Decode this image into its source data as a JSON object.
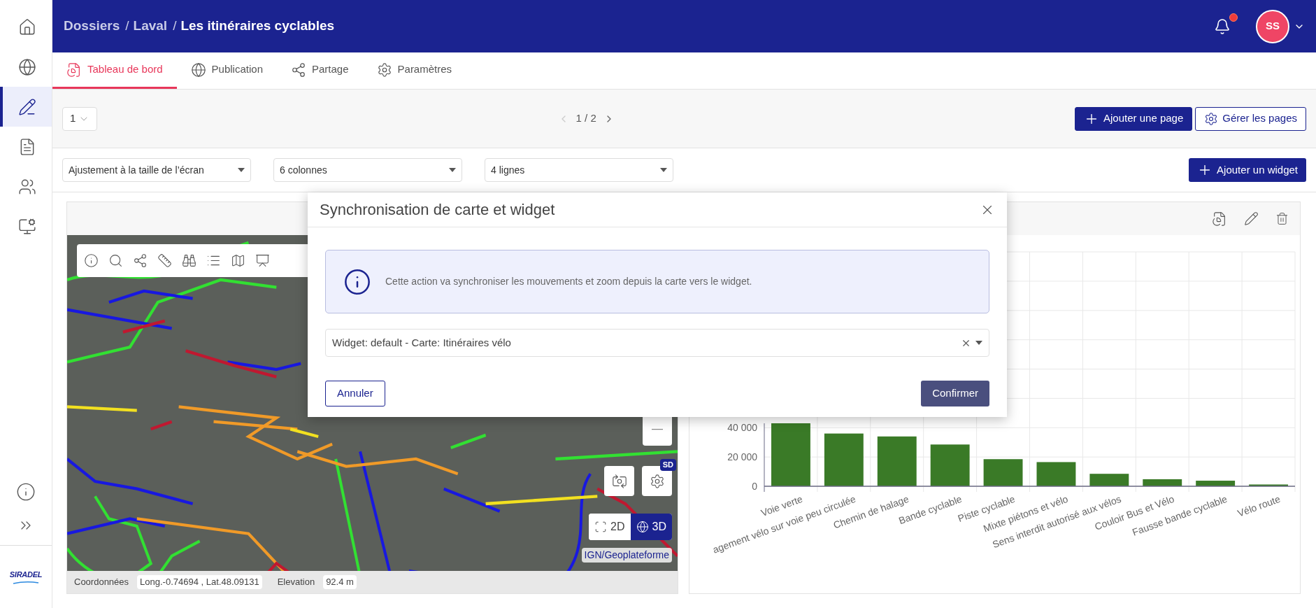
{
  "sidebar": {
    "items": [
      {
        "selected": false
      },
      {
        "selected": false
      },
      {
        "selected": true
      },
      {
        "selected": false
      },
      {
        "selected": false
      },
      {
        "selected": false
      }
    ],
    "logo": "SIRADEL"
  },
  "header": {
    "breadcrumb": [
      {
        "label": "Dossiers",
        "current": false
      },
      {
        "label": "Laval",
        "current": false
      },
      {
        "label": "Les itinéraires cyclables",
        "current": true
      }
    ],
    "separator": "/",
    "notifications_unread": true,
    "avatar": "SS"
  },
  "tabs": [
    {
      "label": "Tableau de bord",
      "selected": true
    },
    {
      "label": "Publication",
      "selected": false
    },
    {
      "label": "Partage",
      "selected": false
    },
    {
      "label": "Paramètres",
      "selected": false
    }
  ],
  "page_toolbar": {
    "page_select": "1",
    "pagination": {
      "label": "1 / 2",
      "prev_disabled": true,
      "next_disabled": false
    },
    "buttons": [
      {
        "label": "Ajouter une page",
        "kind": "primary"
      },
      {
        "label": "Gérer les pages",
        "kind": "secondary"
      }
    ]
  },
  "layout_toolbar": {
    "selects": [
      "Ajustement à la taille de l’écran",
      "6 colonnes",
      "4 lignes"
    ],
    "add_widget": "Ajouter un widget"
  },
  "map_widget": {
    "view_modes": [
      {
        "label": "2D",
        "selected": false
      },
      {
        "label": "3D",
        "selected": true
      }
    ],
    "quality_badge": "SD",
    "attribution": "IGN/Geoplateforme",
    "status": {
      "coords_label": "Coordonnées",
      "coords": "Long.-0.74694 , Lat.48.09131",
      "elevation_label": "Elevation",
      "elevation": "92.4 m"
    }
  },
  "chart_widget": {
    "chart_data": {
      "type": "bar",
      "categories": [
        "Voie verte",
        "agement vélo sur voie peu circulée",
        "Chemin de halage",
        "Bande cyclable",
        "Piste cyclable",
        "Mixte piétons et vélo",
        "Sens interdit autorisé aux vélos",
        "Couloir Bus et Vélo",
        "Fausse bande cyclable",
        "Vélo route"
      ],
      "series": [
        {
          "color": "#3a7a27",
          "values": [
            43000,
            36000,
            34000,
            28500,
            18500,
            16500,
            8500,
            4800,
            3800,
            1200
          ]
        }
      ],
      "ylim": [
        0,
        160000
      ],
      "yticks": [
        {
          "value": 0,
          "label": "0"
        },
        {
          "value": 20000,
          "label": "20 000"
        },
        {
          "value": 40000,
          "label": "40 000"
        }
      ]
    }
  },
  "dialog": {
    "title": "Synchronisation de carte et widget",
    "info": "Cette action va synchroniser les mouvements et zoom depuis la carte vers le widget.",
    "select_value": "Widget: default - Carte: Itinéraires vélo",
    "cancel": "Annuler",
    "confirm": "Confirmer"
  }
}
